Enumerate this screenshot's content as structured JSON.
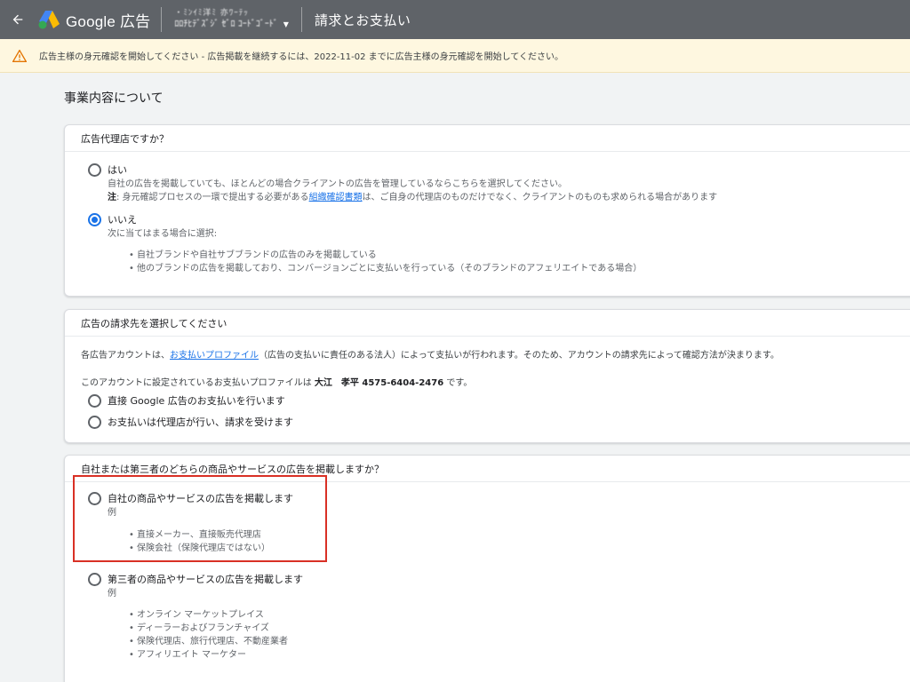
{
  "header": {
    "back_icon": "arrow-back-icon",
    "product_name": "Google 広告",
    "account_line1": "・ﾐﾝｲﾐ洋ﾐ 亦ﾜｰﾃｯ",
    "account_line2": "ﾛﾛﾁﾋﾃﾞｽﾞｼﾞ ｾﾞﾛ ｺｰﾄﾞｺﾞｰﾄﾞ",
    "page_title": "請求とお支払い"
  },
  "warning": {
    "icon": "warning-icon",
    "text": "広告主様の身元確認を開始してください - 広告掲載を継続するには、2022-11-02 までに広告主様の身元確認を開始してください。"
  },
  "section_title": "事業内容について",
  "card_agency": {
    "header": "広告代理店ですか？",
    "yes": {
      "label": "はい",
      "desc": "自社の広告を掲載していても、ほとんどの場合クライアントの広告を管理しているならこちらを選択してください。",
      "note_bold": "注",
      "note_pre": ": 身元確認プロセスの一環で提出する必要がある",
      "note_link": "組織確認書類",
      "note_post": "は、ご自身の代理店のものだけでなく、クライアントのものも求められる場合があります"
    },
    "no": {
      "label": "いいえ",
      "desc": "次に当てはまる場合に選択:",
      "bullets": [
        "自社ブランドや自社サブブランドの広告のみを掲載している",
        "他のブランドの広告を掲載しており、コンバージョンごとに支払いを行っている（そのブランドのアフェリエイトである場合）"
      ]
    }
  },
  "card_billing": {
    "header": "広告の請求先を選択してください",
    "line1_pre": "各広告アカウントは、",
    "line1_link": "お支払いプロファイル",
    "line1_post": "（広告の支払いに責任のある法人）によって支払いが行われます。そのため、アカウントの請求先によって確認方法が決まります。",
    "line2_pre": "このアカウントに設定されているお支払いプロファイルは ",
    "line2_bold": "大江　孝平 4575-6404-2476",
    "line2_post": " です。",
    "option1": "直接 Google 広告のお支払いを行います",
    "option2": "お支払いは代理店が行い、請求を受けます"
  },
  "card_products": {
    "header": "自社または第三者のどちらの商品やサービスの広告を掲載しますか？",
    "own": {
      "label": "自社の商品やサービスの広告を掲載します",
      "example": "例",
      "bullets": [
        "直接メーカー、直接販売代理店",
        "保険会社（保険代理店ではない）"
      ]
    },
    "third": {
      "label": "第三者の商品やサービスの広告を掲載します",
      "example": "例",
      "bullets": [
        "オンライン マーケットプレイス",
        "ディーラーおよびフランチャイズ",
        "保険代理店、旅行代理店、不動産業者",
        "アフィリエイト マーケター"
      ]
    }
  },
  "colors": {
    "topbar": "#5f6368",
    "warning_bg": "#fef7e0",
    "accent": "#1a73e8",
    "highlight": "#d93025"
  }
}
